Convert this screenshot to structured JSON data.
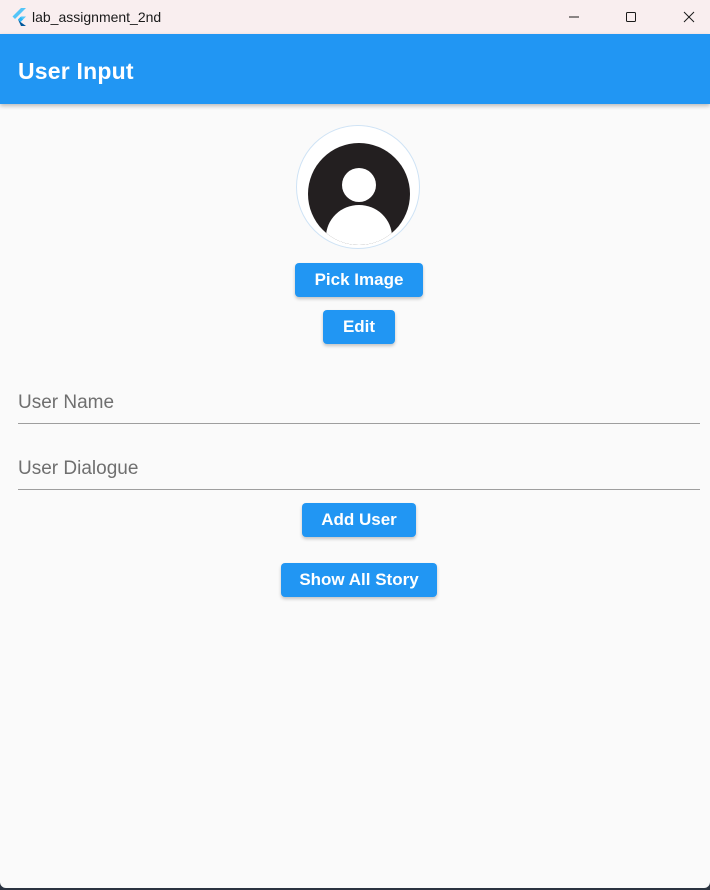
{
  "window": {
    "title": "lab_assignment_2nd",
    "app_icon": "flutter-logo-icon",
    "controls": [
      "minimize-icon",
      "maximize-icon",
      "close-icon"
    ]
  },
  "appbar": {
    "title": "User Input",
    "color": "#2196f3"
  },
  "avatar": {
    "icon": "person-placeholder-icon"
  },
  "buttons": {
    "pick_image": "Pick Image",
    "edit": "Edit",
    "add_user": "Add User",
    "show_all_story": "Show All Story"
  },
  "fields": {
    "user_name": {
      "placeholder": "User Name",
      "value": ""
    },
    "user_dialogue": {
      "placeholder": "User Dialogue",
      "value": ""
    }
  },
  "colors": {
    "accent": "#2196f3",
    "background": "#fafafa",
    "titlebar": "#f9eeef"
  }
}
